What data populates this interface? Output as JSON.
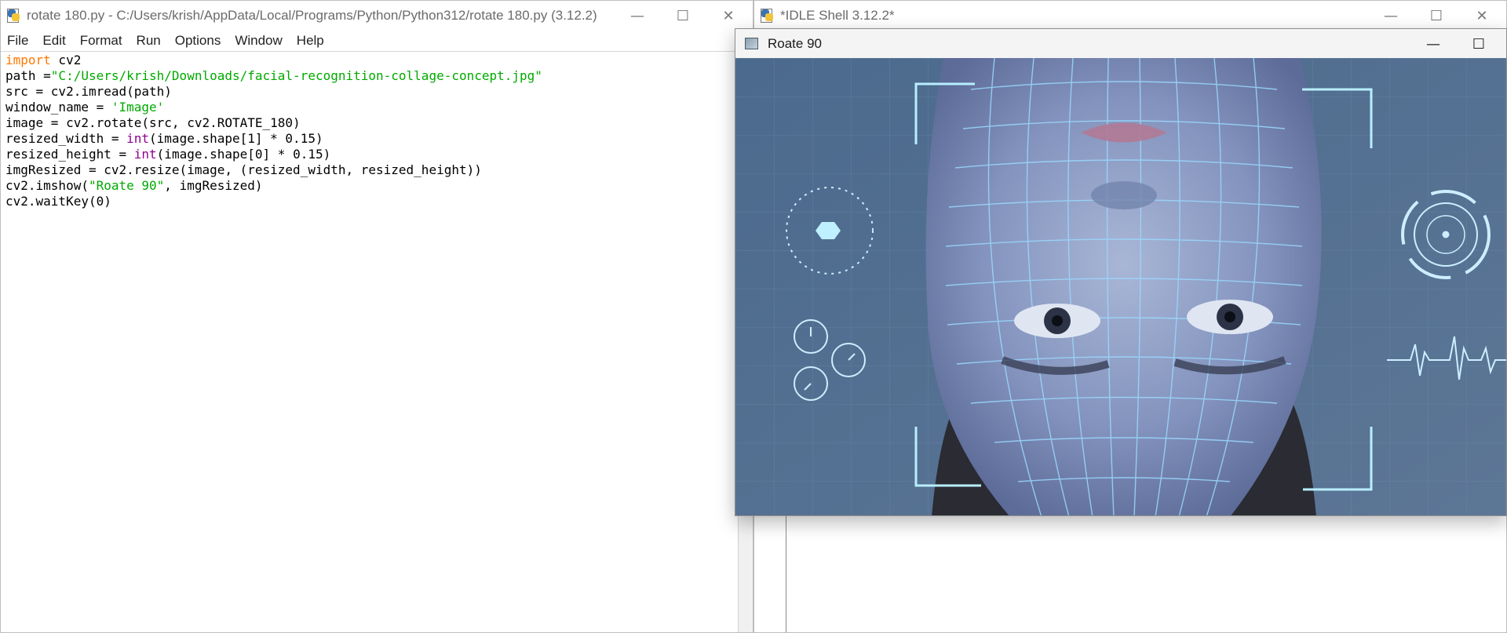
{
  "editor": {
    "title": "rotate 180.py - C:/Users/krish/AppData/Local/Programs/Python/Python312/rotate 180.py (3.12.2)",
    "menu": [
      "File",
      "Edit",
      "Format",
      "Run",
      "Options",
      "Window",
      "Help"
    ],
    "code": {
      "l1_kw": "import",
      "l1_rest": " cv2",
      "l2_a": "path =",
      "l2_str": "\"C:/Users/krish/Downloads/facial-recognition-collage-concept.jpg\"",
      "l3": "src = cv2.imread(path)",
      "l4_a": "window_name = ",
      "l4_str": "'Image'",
      "l5": "image = cv2.rotate(src, cv2.ROTATE_180)",
      "l6_a": "resized_width = ",
      "l6_bi": "int",
      "l6_b": "(image.shape[1] * 0.15)",
      "l7_a": "resized_height = ",
      "l7_bi": "int",
      "l7_b": "(image.shape[0] * 0.15)",
      "l8": "imgResized = cv2.resize(image, (resized_width, resized_height))",
      "l9_a": "cv2.imshow(",
      "l9_str": "\"Roate 90\"",
      "l9_b": ", imgResized)",
      "l10": "cv2.waitKey(0)"
    },
    "minimize_glyph": "—",
    "maximize_glyph": "☐",
    "close_glyph": "✕"
  },
  "shell": {
    "title": "*IDLE Shell 3.12.2*",
    "minimize_glyph": "—",
    "maximize_glyph": "☐",
    "close_glyph": "✕"
  },
  "image_window": {
    "title": "Roate 90",
    "minimize_glyph": "—",
    "maximize_glyph": "☐",
    "image_icon": "image-icon",
    "colors": {
      "hud": "#a8e6ff",
      "bg": "#4a6588",
      "mesh": "#8fd4ff"
    }
  }
}
